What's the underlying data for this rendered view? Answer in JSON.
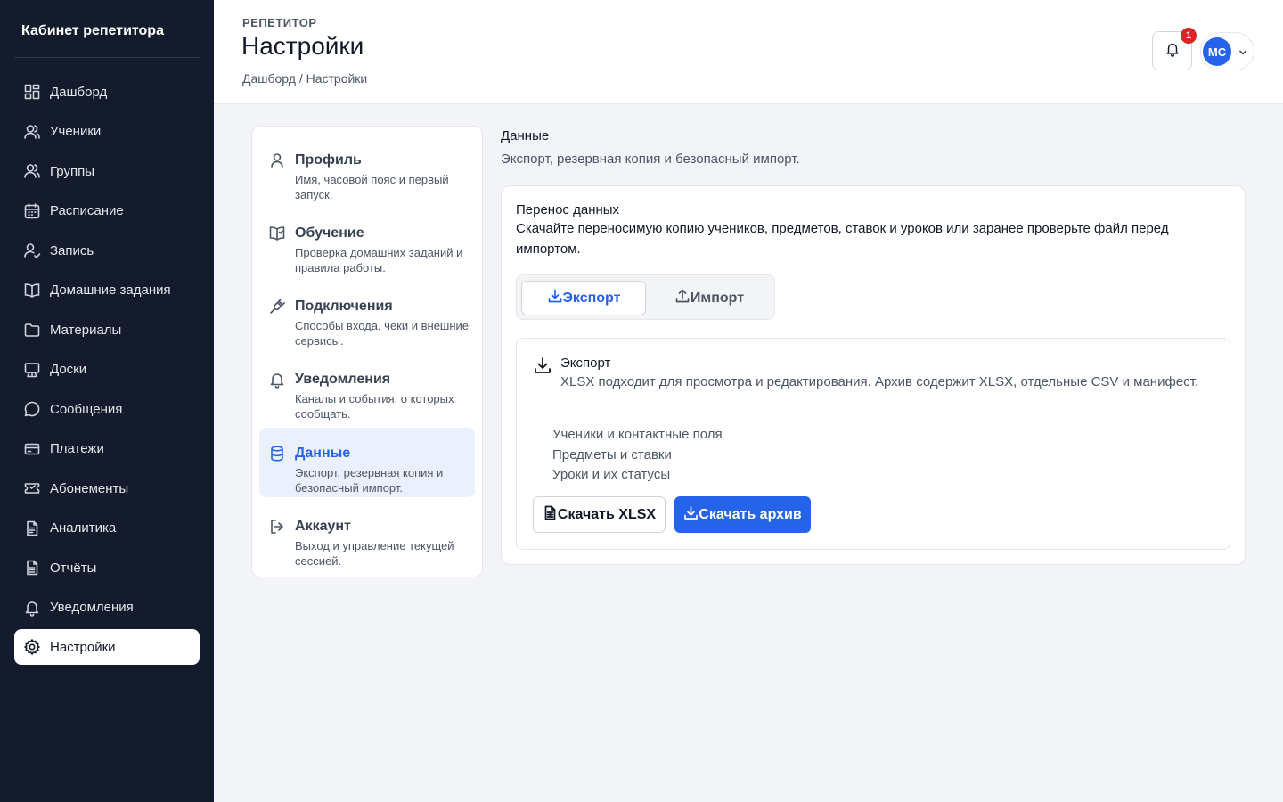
{
  "sidebar": {
    "brand": "Кабинет репетитора",
    "items": [
      {
        "label": "Дашборд",
        "icon": "dashboard-icon"
      },
      {
        "label": "Ученики",
        "icon": "users-icon"
      },
      {
        "label": "Группы",
        "icon": "users-icon"
      },
      {
        "label": "Расписание",
        "icon": "calendar-icon"
      },
      {
        "label": "Запись",
        "icon": "user-plus-icon"
      },
      {
        "label": "Домашние задания",
        "icon": "book-icon"
      },
      {
        "label": "Материалы",
        "icon": "folder-icon"
      },
      {
        "label": "Доски",
        "icon": "board-icon"
      },
      {
        "label": "Сообщения",
        "icon": "message-icon"
      },
      {
        "label": "Платежи",
        "icon": "card-icon"
      },
      {
        "label": "Абонементы",
        "icon": "ticket-icon"
      },
      {
        "label": "Аналитика",
        "icon": "document-icon"
      },
      {
        "label": "Отчёты",
        "icon": "report-icon"
      },
      {
        "label": "Уведомления",
        "icon": "bell-icon"
      },
      {
        "label": "Настройки",
        "icon": "gear-icon",
        "active": true
      }
    ]
  },
  "header": {
    "eyebrow": "РЕПЕТИТОР",
    "title": "Настройки",
    "breadcrumb": "Дашборд / Настройки",
    "notification_count": "1",
    "avatar_initials": "MC"
  },
  "settings_nav": [
    {
      "title": "Профиль",
      "desc": "Имя, часовой пояс и первый запуск.",
      "icon": "user-icon"
    },
    {
      "title": "Обучение",
      "desc": "Проверка домашних заданий и правила работы.",
      "icon": "book-check-icon"
    },
    {
      "title": "Подключения",
      "desc": "Способы входа, чеки и внешние сервисы.",
      "icon": "plug-icon"
    },
    {
      "title": "Уведомления",
      "desc": "Каналы и события, о которых сообщать.",
      "icon": "bell-icon"
    },
    {
      "title": "Данные",
      "desc": "Экспорт, резервная копия и безопасный импорт.",
      "icon": "database-icon",
      "active": true
    },
    {
      "title": "Аккаунт",
      "desc": "Выход и управление текущей сессией.",
      "icon": "logout-icon"
    }
  ],
  "section": {
    "title": "Данные",
    "desc": "Экспорт, резервная копия и безопасный импорт."
  },
  "transfer": {
    "title": "Перенос данных",
    "desc": "Скачайте переносимую копию учеников, предметов, ставок и уроков или заранее проверьте файл перед импортом.",
    "tab_export": "Экспорт",
    "tab_import": "Импорт"
  },
  "export_panel": {
    "title": "Экспорт",
    "desc": "XLSX подходит для просмотра и редактирования. Архив содержит XLSX, отдельные CSV и манифест.",
    "items": [
      "Ученики и контактные поля",
      "Предметы и ставки",
      "Уроки и их статусы"
    ],
    "btn_xlsx": "Скачать XLSX",
    "btn_archive": "Скачать архив"
  },
  "colors": {
    "sidebar_bg": "#141b2d",
    "accent": "#2563eb",
    "badge": "#dc2626"
  }
}
